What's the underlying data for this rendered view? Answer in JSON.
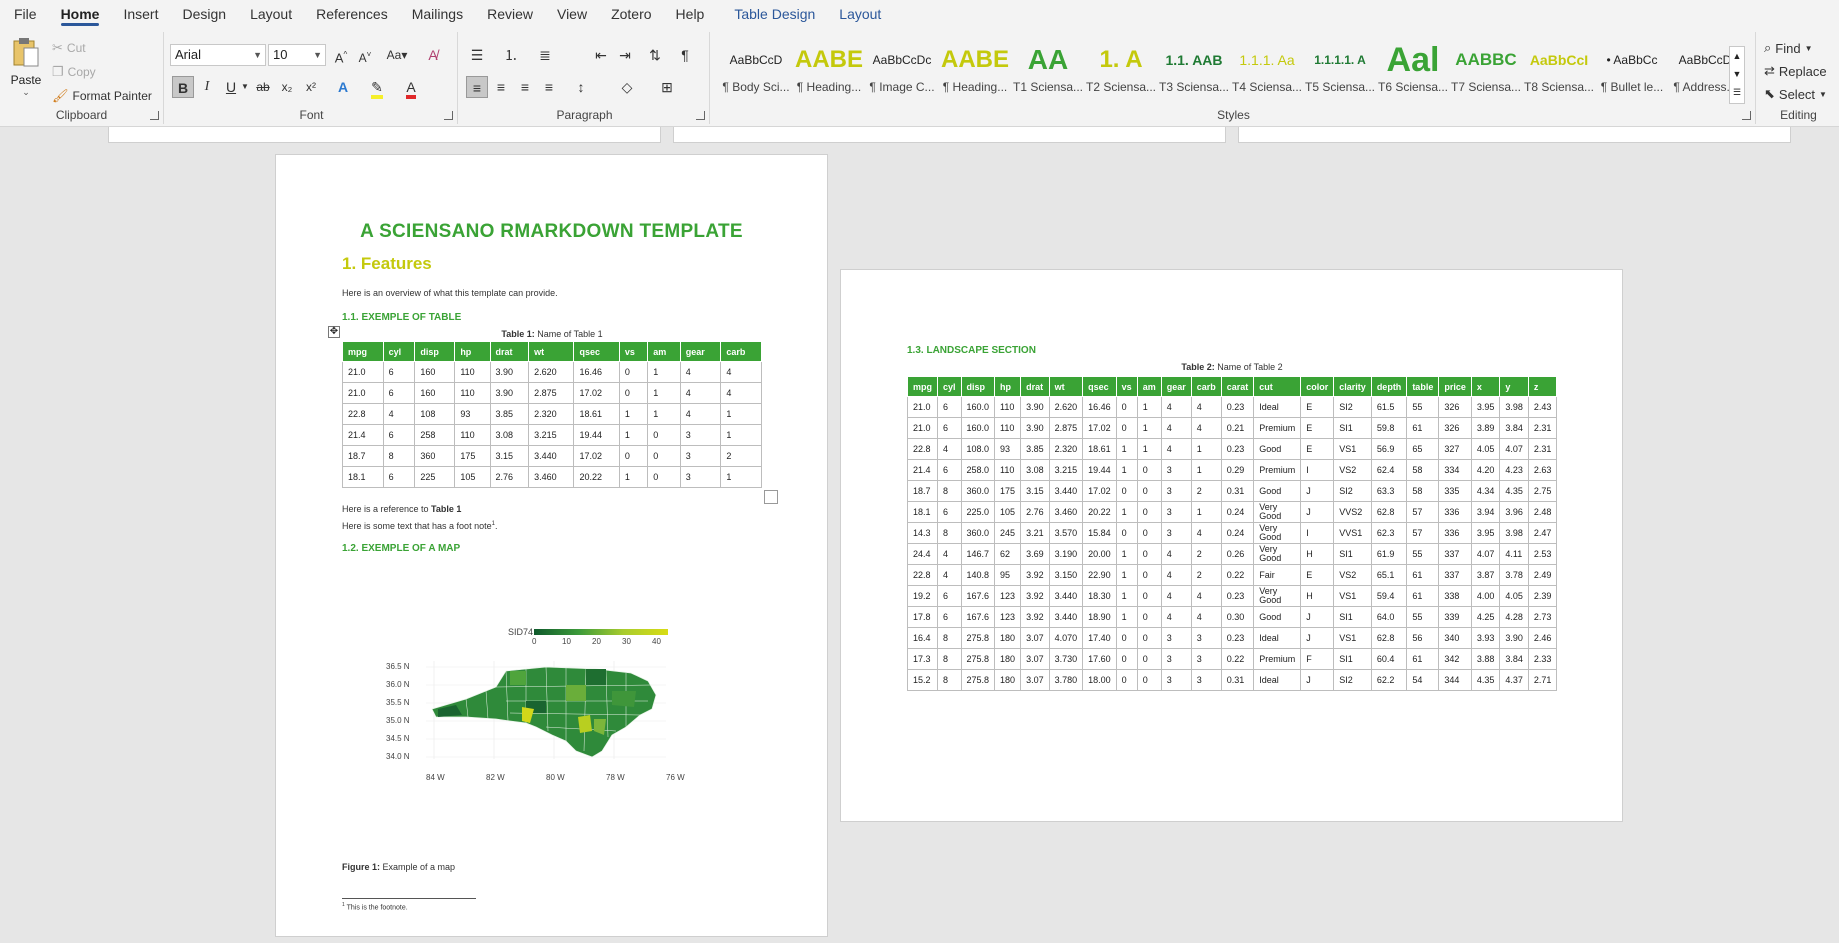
{
  "tabs": [
    "File",
    "Home",
    "Insert",
    "Design",
    "Layout",
    "References",
    "Mailings",
    "Review",
    "View",
    "Zotero",
    "Help",
    "Table Design",
    "Layout"
  ],
  "clipboard": {
    "paste": "Paste",
    "cut": "Cut",
    "copy": "Copy",
    "format_painter": "Format Painter",
    "label": "Clipboard"
  },
  "font": {
    "name": "Arial",
    "size": "10",
    "label": "Font",
    "grow": "A^",
    "shrink": "A˅",
    "case": "Aa",
    "bold": "B",
    "italic": "I",
    "underline": "U",
    "strike": "ab",
    "sub": "x₂",
    "sup": "x²"
  },
  "paragraph": {
    "label": "Paragraph"
  },
  "styles": {
    "label": "Styles",
    "items": [
      {
        "preview": "AaBbCcD",
        "name": "¶ Body Sci..."
      },
      {
        "preview": "AABE",
        "name": "¶ Heading..."
      },
      {
        "preview": "AaBbCcDc",
        "name": "¶ Image C..."
      },
      {
        "preview": "AABE",
        "name": "¶ Heading..."
      },
      {
        "preview": "AA",
        "name": "T1 Sciensa..."
      },
      {
        "preview": "1. A",
        "name": "T2 Sciensa..."
      },
      {
        "preview": "1.1. AAB",
        "name": "T3 Sciensa..."
      },
      {
        "preview": "1.1.1. Aa",
        "name": "T4 Sciensa..."
      },
      {
        "preview": "1.1.1.1. A",
        "name": "T5 Sciensa..."
      },
      {
        "preview": "Aal",
        "name": "T6 Sciensa..."
      },
      {
        "preview": "AABBC",
        "name": "T7 Sciensa..."
      },
      {
        "preview": "AaBbCcI",
        "name": "T8 Sciensa..."
      },
      {
        "preview": "• AaBbCc",
        "name": "¶ Bullet le..."
      },
      {
        "preview": "AaBbCcD",
        "name": "¶ Address..."
      }
    ]
  },
  "editing": {
    "label": "Editing",
    "find": "Find",
    "replace": "Replace",
    "select": "Select"
  },
  "page1": {
    "title": "A SCIENSANO RMARKDOWN TEMPLATE",
    "h1": "1. Features",
    "intro": "Here is an overview of what this template can provide.",
    "h2_table": "1.1. EXEMPLE OF TABLE",
    "caption_bold": "Table 1:",
    "caption_text": " Name of Table 1",
    "table1": {
      "headers": [
        "mpg",
        "cyl",
        "disp",
        "hp",
        "drat",
        "wt",
        "qsec",
        "vs",
        "am",
        "gear",
        "carb"
      ],
      "rows": [
        [
          "21.0",
          "6",
          "160",
          "110",
          "3.90",
          "2.620",
          "16.46",
          "0",
          "1",
          "4",
          "4"
        ],
        [
          "21.0",
          "6",
          "160",
          "110",
          "3.90",
          "2.875",
          "17.02",
          "0",
          "1",
          "4",
          "4"
        ],
        [
          "22.8",
          "4",
          "108",
          "93",
          "3.85",
          "2.320",
          "18.61",
          "1",
          "1",
          "4",
          "1"
        ],
        [
          "21.4",
          "6",
          "258",
          "110",
          "3.08",
          "3.215",
          "19.44",
          "1",
          "0",
          "3",
          "1"
        ],
        [
          "18.7",
          "8",
          "360",
          "175",
          "3.15",
          "3.440",
          "17.02",
          "0",
          "0",
          "3",
          "2"
        ],
        [
          "18.1",
          "6",
          "225",
          "105",
          "2.76",
          "3.460",
          "20.22",
          "1",
          "0",
          "3",
          "1"
        ]
      ]
    },
    "ref_prefix": "Here is a reference to ",
    "ref_bold": "Table 1",
    "footnote_text": "Here is some text that has a foot note",
    "footnote_mark": "1",
    "h2_map": "1.2. EXEMPLE OF A MAP",
    "map": {
      "legend_title": "SID74",
      "legend_ticks": [
        "0",
        "10",
        "20",
        "30",
        "40"
      ],
      "lat_labels": [
        "36.5 N",
        "36.0 N",
        "35.5 N",
        "35.0 N",
        "34.5 N",
        "34.0 N"
      ],
      "lon_labels": [
        "84 W",
        "82 W",
        "80 W",
        "78 W",
        "76 W"
      ]
    },
    "fig_bold": "Figure 1:",
    "fig_text": " Example of a map",
    "footnote": "This is the footnote."
  },
  "page2": {
    "h2": "1.3. LANDSCAPE SECTION",
    "caption_bold": "Table 2:",
    "caption_text": " Name of Table 2",
    "table2": {
      "headers": [
        "mpg",
        "cyl",
        "disp",
        "hp",
        "drat",
        "wt",
        "qsec",
        "vs",
        "am",
        "gear",
        "carb",
        "carat",
        "cut",
        "color",
        "clarity",
        "depth",
        "table",
        "price",
        "x",
        "y",
        "z"
      ],
      "rows": [
        [
          "21.0",
          "6",
          "160.0",
          "110",
          "3.90",
          "2.620",
          "16.46",
          "0",
          "1",
          "4",
          "4",
          "0.23",
          "Ideal",
          "E",
          "SI2",
          "61.5",
          "55",
          "326",
          "3.95",
          "3.98",
          "2.43"
        ],
        [
          "21.0",
          "6",
          "160.0",
          "110",
          "3.90",
          "2.875",
          "17.02",
          "0",
          "1",
          "4",
          "4",
          "0.21",
          "Premium",
          "E",
          "SI1",
          "59.8",
          "61",
          "326",
          "3.89",
          "3.84",
          "2.31"
        ],
        [
          "22.8",
          "4",
          "108.0",
          "93",
          "3.85",
          "2.320",
          "18.61",
          "1",
          "1",
          "4",
          "1",
          "0.23",
          "Good",
          "E",
          "VS1",
          "56.9",
          "65",
          "327",
          "4.05",
          "4.07",
          "2.31"
        ],
        [
          "21.4",
          "6",
          "258.0",
          "110",
          "3.08",
          "3.215",
          "19.44",
          "1",
          "0",
          "3",
          "1",
          "0.29",
          "Premium",
          "I",
          "VS2",
          "62.4",
          "58",
          "334",
          "4.20",
          "4.23",
          "2.63"
        ],
        [
          "18.7",
          "8",
          "360.0",
          "175",
          "3.15",
          "3.440",
          "17.02",
          "0",
          "0",
          "3",
          "2",
          "0.31",
          "Good",
          "J",
          "SI2",
          "63.3",
          "58",
          "335",
          "4.34",
          "4.35",
          "2.75"
        ],
        [
          "18.1",
          "6",
          "225.0",
          "105",
          "2.76",
          "3.460",
          "20.22",
          "1",
          "0",
          "3",
          "1",
          "0.24",
          "Very Good",
          "J",
          "VVS2",
          "62.8",
          "57",
          "336",
          "3.94",
          "3.96",
          "2.48"
        ],
        [
          "14.3",
          "8",
          "360.0",
          "245",
          "3.21",
          "3.570",
          "15.84",
          "0",
          "0",
          "3",
          "4",
          "0.24",
          "Very Good",
          "I",
          "VVS1",
          "62.3",
          "57",
          "336",
          "3.95",
          "3.98",
          "2.47"
        ],
        [
          "24.4",
          "4",
          "146.7",
          "62",
          "3.69",
          "3.190",
          "20.00",
          "1",
          "0",
          "4",
          "2",
          "0.26",
          "Very Good",
          "H",
          "SI1",
          "61.9",
          "55",
          "337",
          "4.07",
          "4.11",
          "2.53"
        ],
        [
          "22.8",
          "4",
          "140.8",
          "95",
          "3.92",
          "3.150",
          "22.90",
          "1",
          "0",
          "4",
          "2",
          "0.22",
          "Fair",
          "E",
          "VS2",
          "65.1",
          "61",
          "337",
          "3.87",
          "3.78",
          "2.49"
        ],
        [
          "19.2",
          "6",
          "167.6",
          "123",
          "3.92",
          "3.440",
          "18.30",
          "1",
          "0",
          "4",
          "4",
          "0.23",
          "Very Good",
          "H",
          "VS1",
          "59.4",
          "61",
          "338",
          "4.00",
          "4.05",
          "2.39"
        ],
        [
          "17.8",
          "6",
          "167.6",
          "123",
          "3.92",
          "3.440",
          "18.90",
          "1",
          "0",
          "4",
          "4",
          "0.30",
          "Good",
          "J",
          "SI1",
          "64.0",
          "55",
          "339",
          "4.25",
          "4.28",
          "2.73"
        ],
        [
          "16.4",
          "8",
          "275.8",
          "180",
          "3.07",
          "4.070",
          "17.40",
          "0",
          "0",
          "3",
          "3",
          "0.23",
          "Ideal",
          "J",
          "VS1",
          "62.8",
          "56",
          "340",
          "3.93",
          "3.90",
          "2.46"
        ],
        [
          "17.3",
          "8",
          "275.8",
          "180",
          "3.07",
          "3.730",
          "17.60",
          "0",
          "0",
          "3",
          "3",
          "0.22",
          "Premium",
          "F",
          "SI1",
          "60.4",
          "61",
          "342",
          "3.88",
          "3.84",
          "2.33"
        ],
        [
          "15.2",
          "8",
          "275.8",
          "180",
          "3.07",
          "3.780",
          "18.00",
          "0",
          "0",
          "3",
          "3",
          "0.31",
          "Ideal",
          "J",
          "SI2",
          "62.2",
          "54",
          "344",
          "4.35",
          "4.37",
          "2.71"
        ]
      ]
    }
  }
}
